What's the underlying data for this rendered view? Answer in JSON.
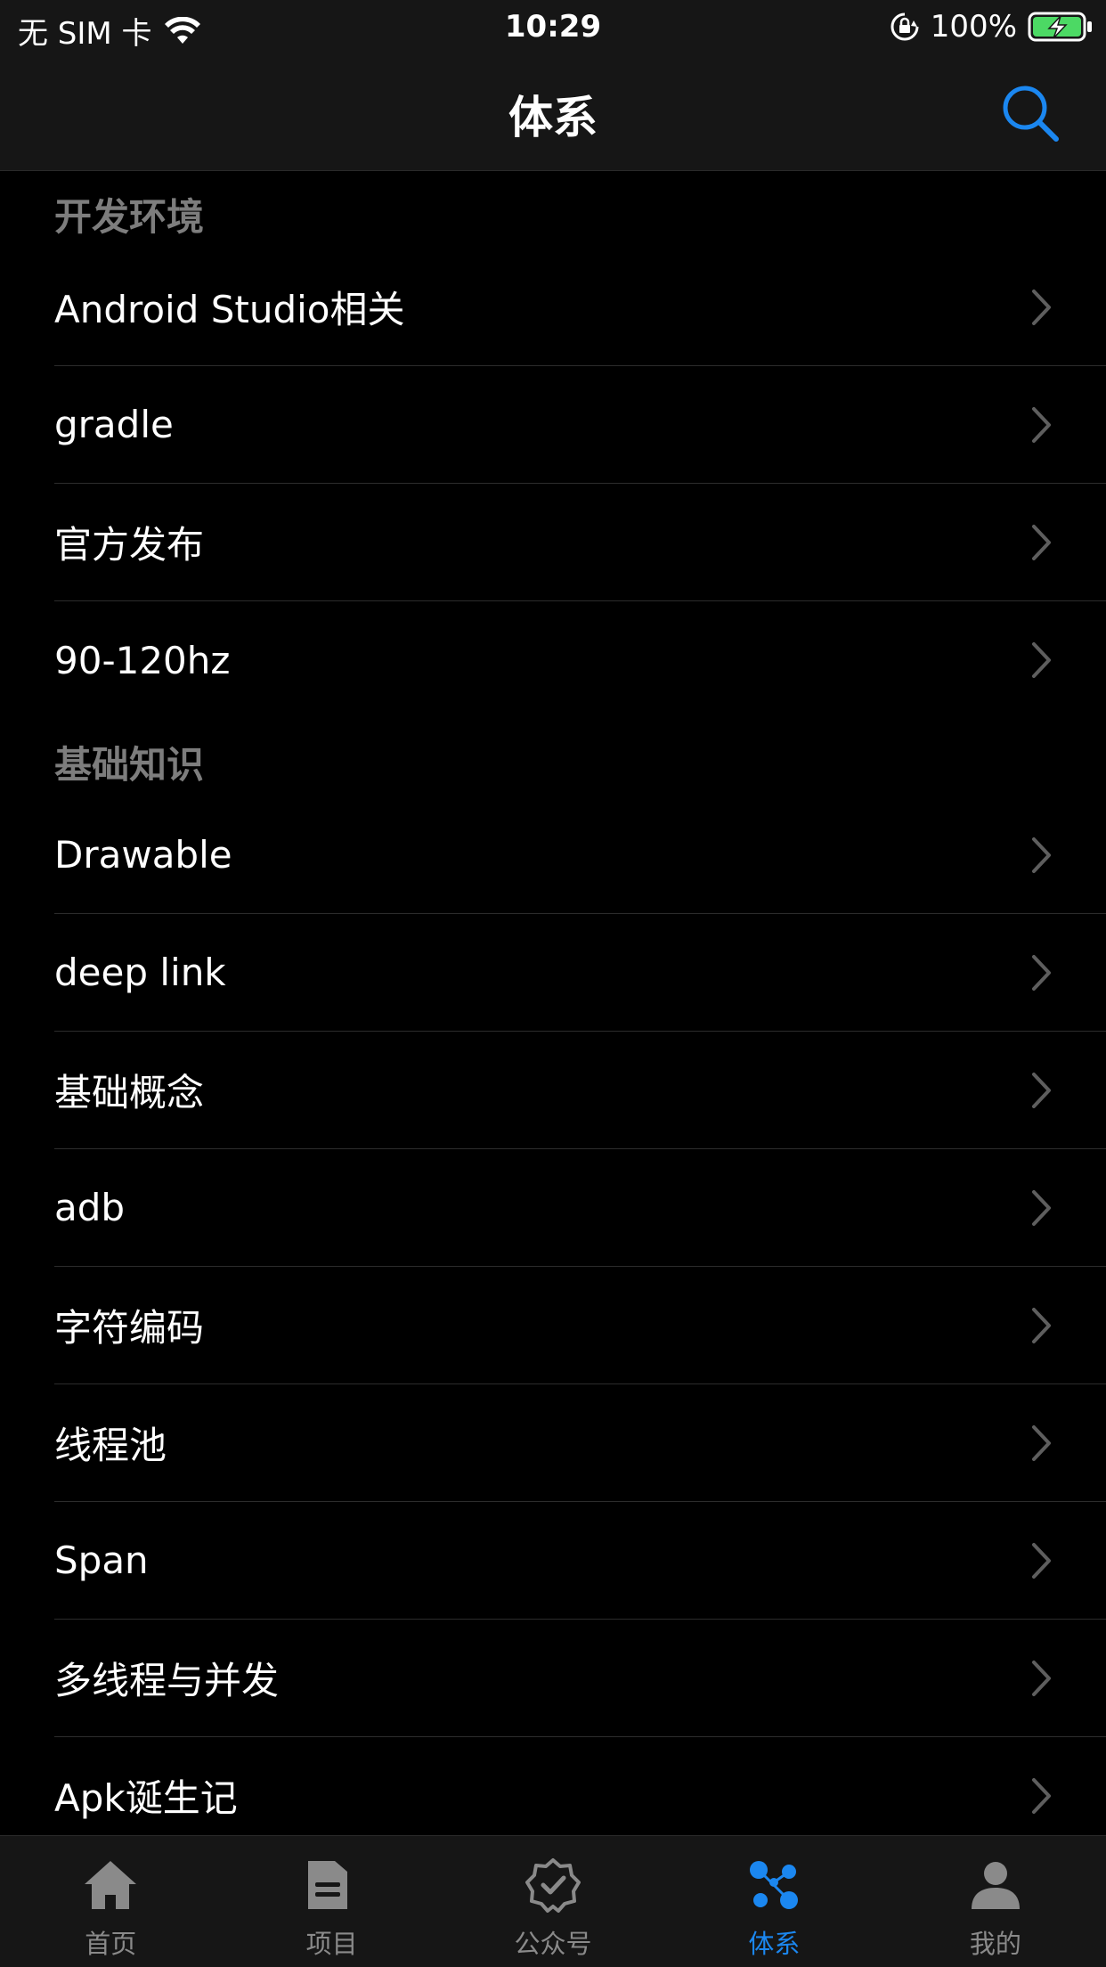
{
  "status_bar": {
    "carrier": "无 SIM 卡",
    "time": "10:29",
    "battery_percent": "100%"
  },
  "nav": {
    "title": "体系",
    "search_icon": "search-icon"
  },
  "sections": [
    {
      "title": "开发环境",
      "items": [
        "Android Studio相关",
        "gradle",
        "官方发布",
        "90-120hz"
      ]
    },
    {
      "title": "基础知识",
      "items": [
        "Drawable",
        "deep link",
        "基础概念",
        "adb",
        "字符编码",
        "线程池",
        "Span",
        "多线程与并发",
        "Apk诞生记"
      ]
    }
  ],
  "tabs": [
    {
      "label": "首页",
      "icon": "home-icon"
    },
    {
      "label": "项目",
      "icon": "folder-icon"
    },
    {
      "label": "公众号",
      "icon": "verified-badge-icon"
    },
    {
      "label": "体系",
      "icon": "hierarchy-icon"
    },
    {
      "label": "我的",
      "icon": "person-icon"
    }
  ],
  "active_tab": 3,
  "colors": {
    "accent": "#1b87f0",
    "background": "#000000",
    "bar_background": "#161616",
    "section_header": "#7d7d7d",
    "battery": "#4cd964"
  }
}
